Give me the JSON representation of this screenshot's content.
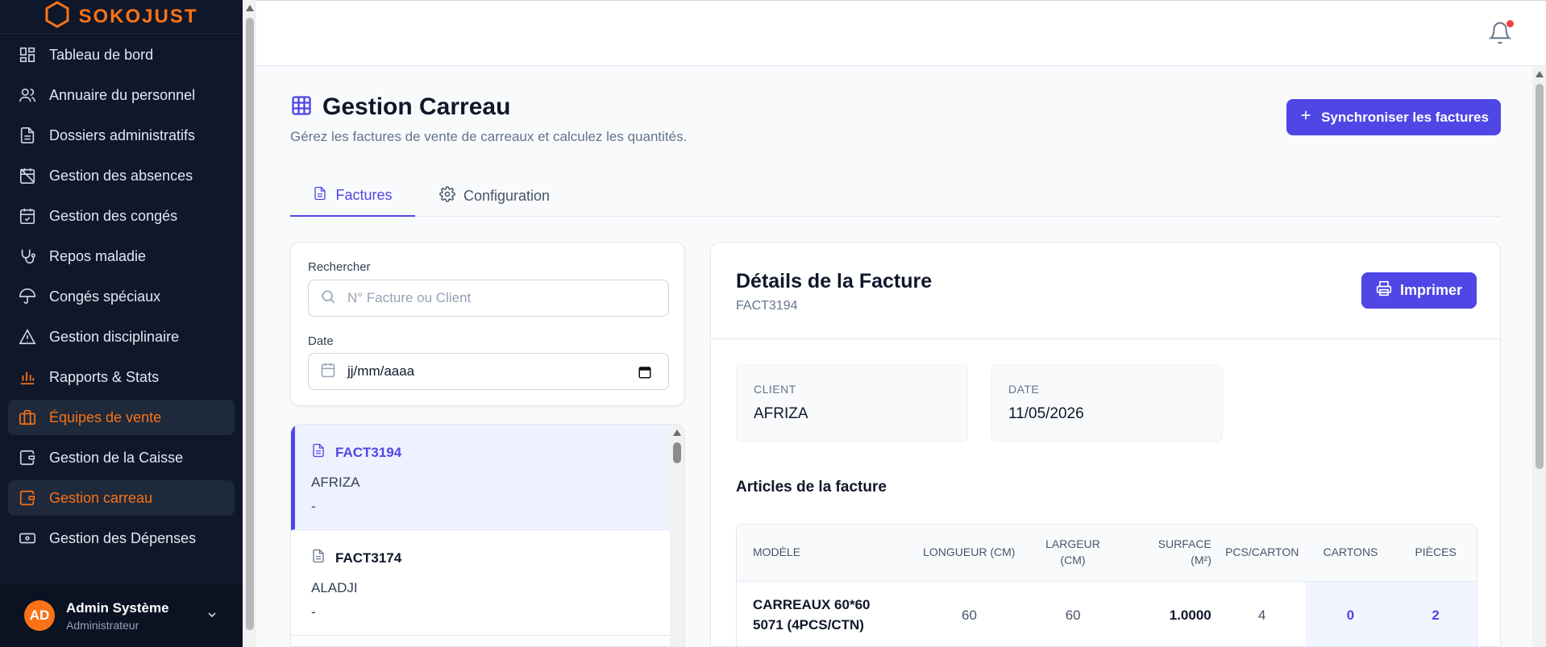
{
  "brand": {
    "name": "SOKOJUST",
    "color": "#f97316"
  },
  "sidebar": {
    "items": [
      {
        "label": "Tableau de bord",
        "icon": "dashboard-icon"
      },
      {
        "label": "Annuaire du personnel",
        "icon": "users-icon"
      },
      {
        "label": "Dossiers administratifs",
        "icon": "file-icon"
      },
      {
        "label": "Gestion des absences",
        "icon": "calendar-off-icon"
      },
      {
        "label": "Gestion des congés",
        "icon": "calendar-check-icon"
      },
      {
        "label": "Repos maladie",
        "icon": "stethoscope-icon"
      },
      {
        "label": "Congés spéciaux",
        "icon": "umbrella-icon"
      },
      {
        "label": "Gestion disciplinaire",
        "icon": "warning-icon"
      },
      {
        "label": "Rapports & Stats",
        "icon": "bar-chart-icon"
      },
      {
        "label": "Équipes de vente",
        "icon": "briefcase-icon"
      },
      {
        "label": "Gestion de la Caisse",
        "icon": "wallet-icon"
      },
      {
        "label": "Gestion carreau",
        "icon": "wallet-icon"
      },
      {
        "label": "Gestion des Dépenses",
        "icon": "banknote-icon"
      }
    ]
  },
  "user": {
    "initials": "AD",
    "name": "Admin Système",
    "role": "Administrateur"
  },
  "header": {
    "title": "Gestion Carreau",
    "subtitle": "Gérez les factures de vente de carreaux et calculez les quantités.",
    "sync_label": "Synchroniser les factures"
  },
  "tabs": [
    {
      "label": "Factures",
      "active": true
    },
    {
      "label": "Configuration",
      "active": false
    }
  ],
  "filters": {
    "search_label": "Rechercher",
    "search_placeholder": "N° Facture ou Client",
    "date_label": "Date",
    "date_value": "jj/mm/aaaa"
  },
  "invoices": [
    {
      "id": "FACT3194",
      "client": "AFRIZA",
      "extra": "-",
      "selected": true
    },
    {
      "id": "FACT3174",
      "client": "ALADJI",
      "extra": "-",
      "selected": false
    }
  ],
  "details": {
    "title": "Détails de la Facture",
    "invoice_id": "FACT3194",
    "print_label": "Imprimer",
    "client_label": "CLIENT",
    "client_value": "AFRIZA",
    "date_label": "DATE",
    "date_value": "11/05/2026",
    "articles_title": "Articles de la facture",
    "columns": [
      "MODÈLE",
      "LONGUEUR (CM)",
      "LARGEUR (CM)",
      "SURFACE (M²)",
      "PCS/CARTON",
      "CARTONS",
      "PIÈCES"
    ],
    "rows": [
      {
        "model": "CARREAUX 60*60 5071 (4PCS/CTN)",
        "longueur": "60",
        "largeur": "60",
        "surface": "1.0000",
        "pcs_carton": "4",
        "cartons": "0",
        "pieces": "2"
      }
    ]
  },
  "colors": {
    "accent": "#4f46e5",
    "sidebar_bg": "#0f172a",
    "orange": "#f97316",
    "notification": "#ef4444"
  }
}
